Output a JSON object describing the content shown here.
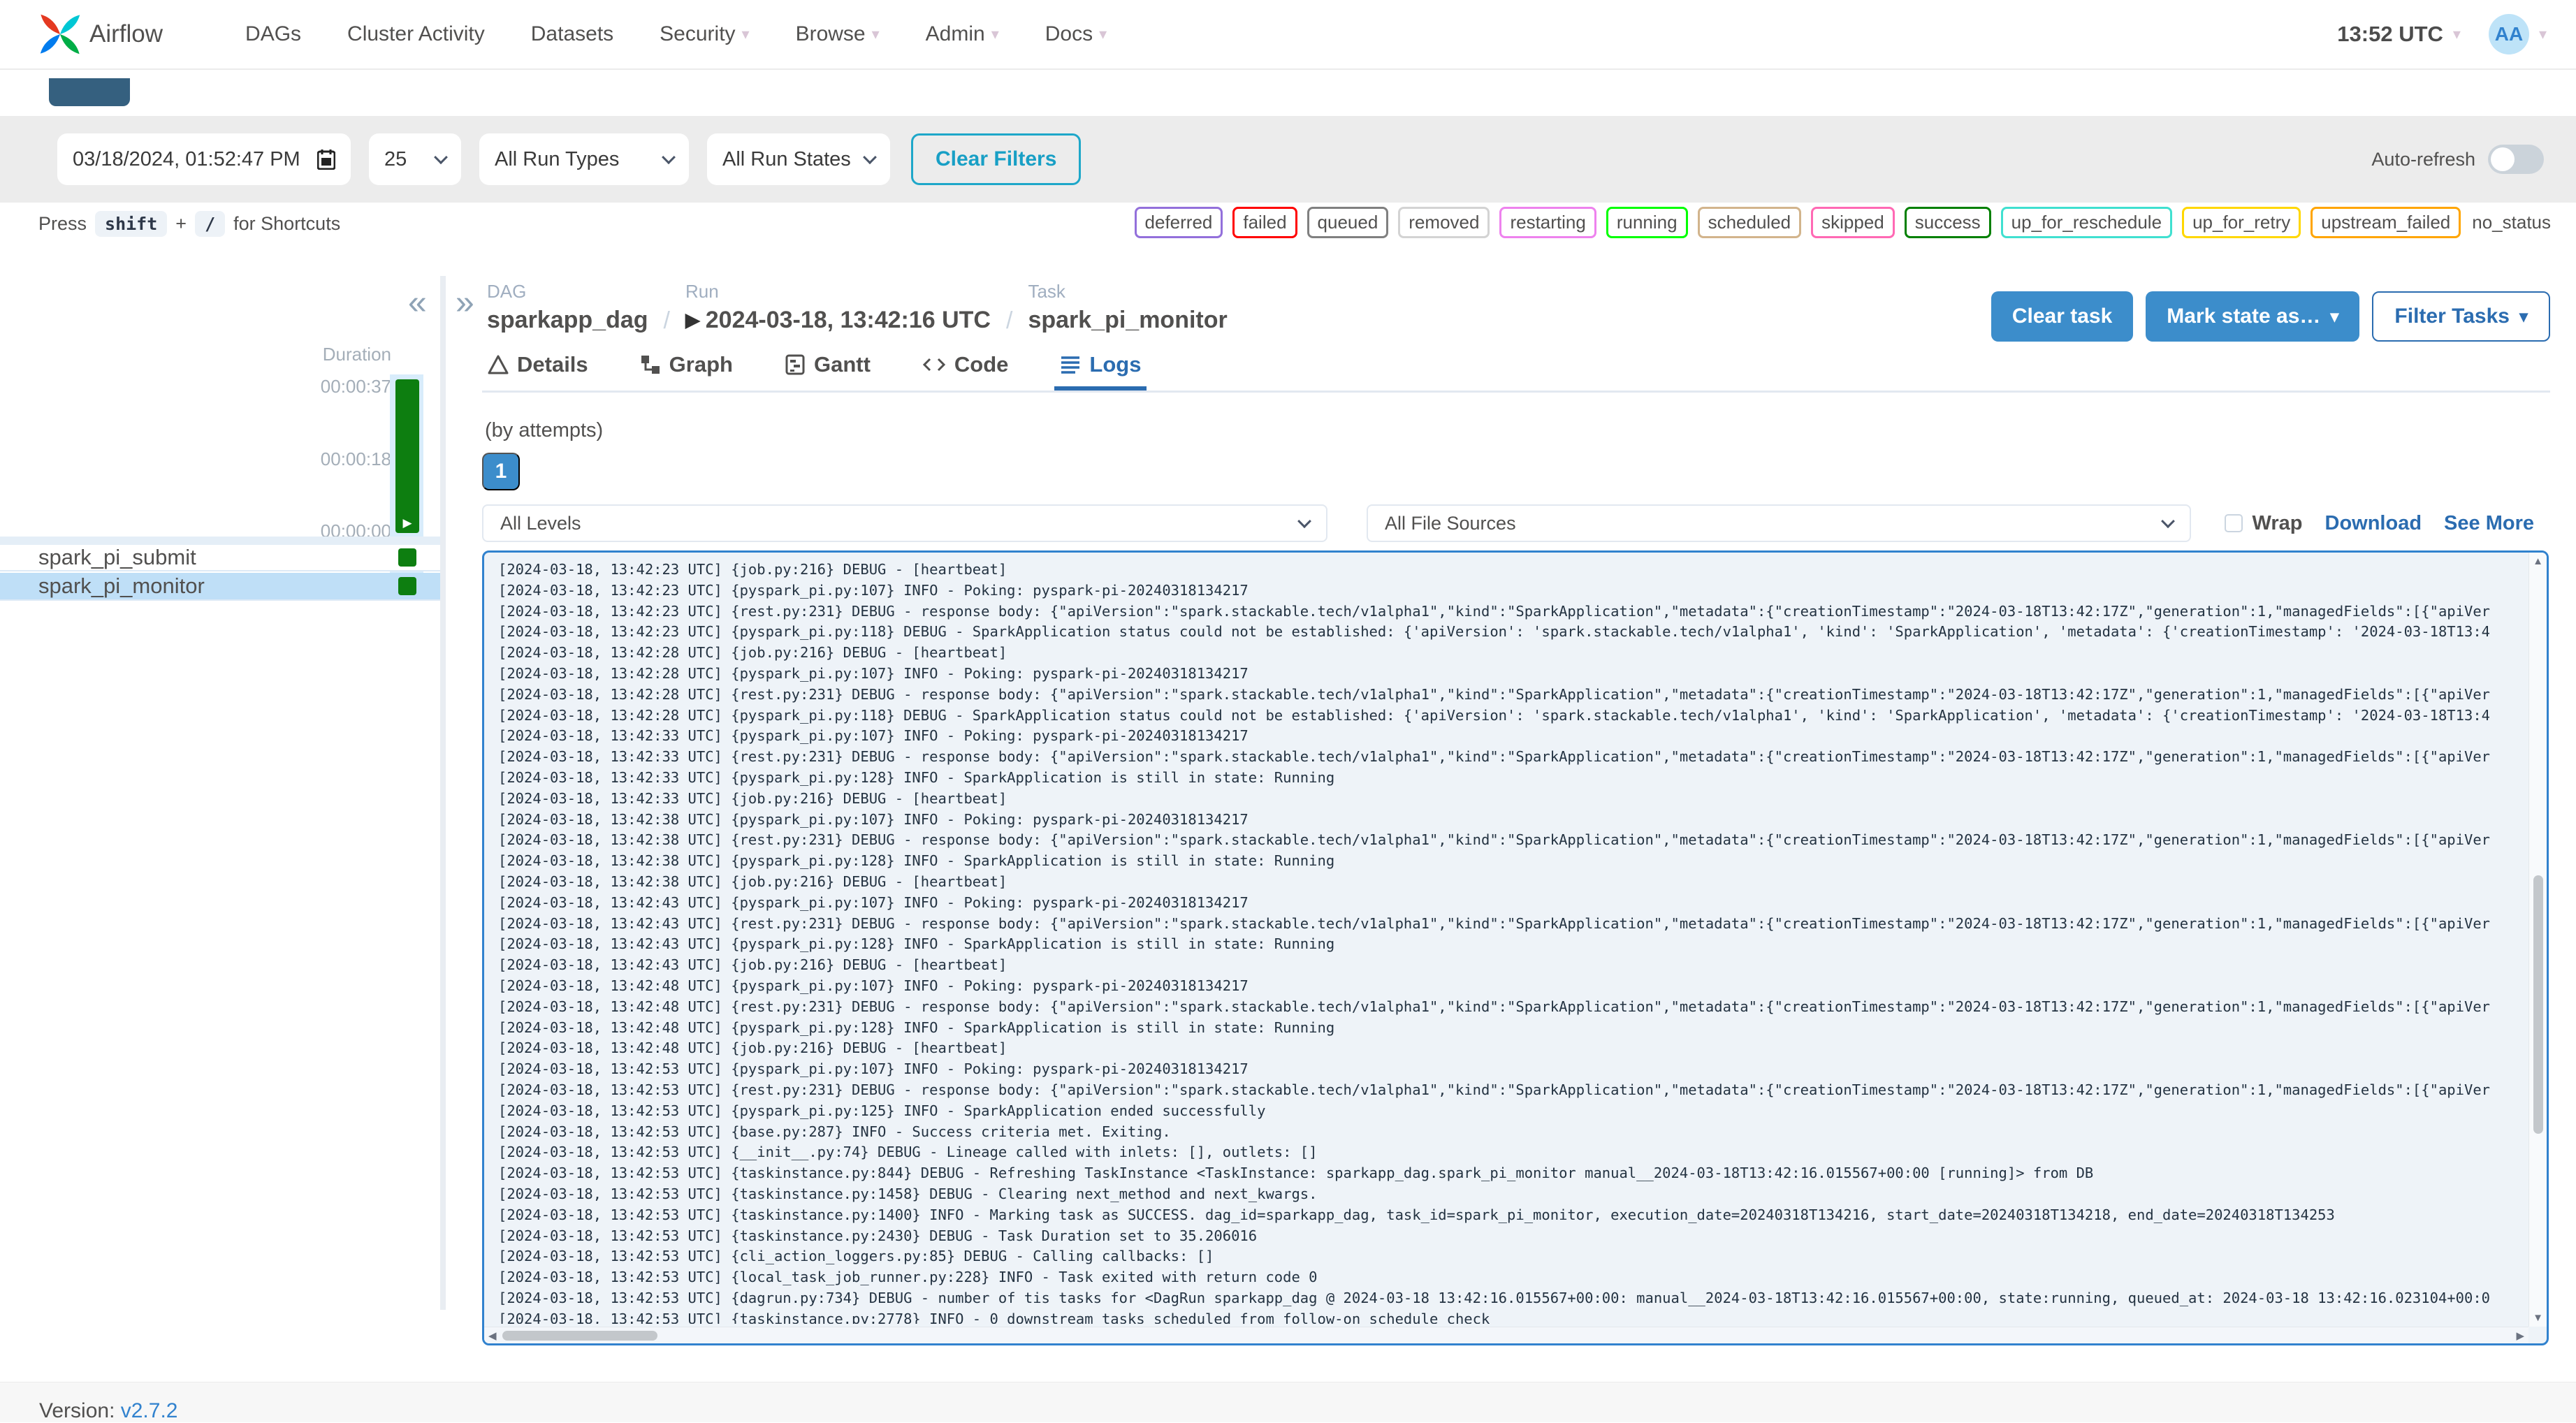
{
  "navbar": {
    "brand": "Airflow",
    "items": [
      {
        "label": "DAGs",
        "caret": false
      },
      {
        "label": "Cluster Activity",
        "caret": false
      },
      {
        "label": "Datasets",
        "caret": false
      },
      {
        "label": "Security",
        "caret": true
      },
      {
        "label": "Browse",
        "caret": true
      },
      {
        "label": "Admin",
        "caret": true
      },
      {
        "label": "Docs",
        "caret": true
      }
    ],
    "clock": "13:52 UTC",
    "avatar_initials": "AA"
  },
  "filter_bar": {
    "date_value": "03/18/2024, 01:52:47 PM",
    "page_size": "25",
    "run_types": "All Run Types",
    "run_states": "All Run States",
    "clear_filters": "Clear Filters",
    "auto_refresh_label": "Auto-refresh"
  },
  "shortcuts": {
    "press": "Press",
    "key1": "shift",
    "plus": "+",
    "key2": "/",
    "suffix": "for Shortcuts"
  },
  "statuses": [
    {
      "label": "deferred",
      "color": "mediumpurple"
    },
    {
      "label": "failed",
      "color": "red"
    },
    {
      "label": "queued",
      "color": "gray"
    },
    {
      "label": "removed",
      "color": "lightgrey"
    },
    {
      "label": "restarting",
      "color": "violet"
    },
    {
      "label": "running",
      "color": "lime"
    },
    {
      "label": "scheduled",
      "color": "tan"
    },
    {
      "label": "skipped",
      "color": "hotpink"
    },
    {
      "label": "success",
      "color": "green"
    },
    {
      "label": "up_for_reschedule",
      "color": "turquoise"
    },
    {
      "label": "up_for_retry",
      "color": "gold"
    },
    {
      "label": "upstream_failed",
      "color": "orange"
    },
    {
      "label": "no_status",
      "plain": true
    }
  ],
  "grid": {
    "duration_label": "Duration",
    "ticks": [
      {
        "t": "00:00:37"
      },
      {
        "t": "00:00:18"
      },
      {
        "t": "00:00:00"
      }
    ],
    "tasks": [
      {
        "name": "spark_pi_submit",
        "selected": false
      },
      {
        "name": "spark_pi_monitor",
        "selected": true
      }
    ]
  },
  "breadcrumb": {
    "dag_label": "DAG",
    "dag": "sparkapp_dag",
    "run_label": "Run",
    "run": "2024-03-18, 13:42:16 UTC",
    "task_label": "Task",
    "task": "spark_pi_monitor"
  },
  "actions": {
    "clear_task": "Clear task",
    "mark_state": "Mark state as…",
    "filter_tasks": "Filter Tasks"
  },
  "tabs": [
    {
      "label": "Details"
    },
    {
      "label": "Graph"
    },
    {
      "label": "Gantt"
    },
    {
      "label": "Code"
    },
    {
      "label": "Logs",
      "active": true
    }
  ],
  "logs": {
    "by_attempts": "(by attempts)",
    "attempt": "1",
    "level_filter": "All Levels",
    "source_filter": "All File Sources",
    "wrap_label": "Wrap",
    "download_label": "Download",
    "see_more_label": "See More",
    "lines": [
      {
        "text": "[2024-03-18, 13:42:23 UTC] {job.py:216} DEBUG - [heartbeat]"
      },
      {
        "text": "[2024-03-18, 13:42:23 UTC] {pyspark_pi.py:107} INFO - Poking: pyspark-pi-20240318134217"
      },
      {
        "text": "[2024-03-18, 13:42:23 UTC] {rest.py:231} DEBUG - response body: {\"apiVersion\":\"spark.stackable.tech/v1alpha1\",\"kind\":\"SparkApplication\",\"metadata\":{\"creationTimestamp\":\"2024-03-18T13:42:17Z\",\"generation\":1,\"managedFields\":[{\"apiVer"
      },
      {
        "text": "[2024-03-18, 13:42:23 UTC] {pyspark_pi.py:118} DEBUG - SparkApplication status could not be established: {'apiVersion': 'spark.stackable.tech/v1alpha1', 'kind': 'SparkApplication', 'metadata': {'creationTimestamp': '2024-03-18T13:4"
      },
      {
        "text": "[2024-03-18, 13:42:28 UTC] {job.py:216} DEBUG - [heartbeat]"
      },
      {
        "text": "[2024-03-18, 13:42:28 UTC] {pyspark_pi.py:107} INFO - Poking: pyspark-pi-20240318134217"
      },
      {
        "text": "[2024-03-18, 13:42:28 UTC] {rest.py:231} DEBUG - response body: {\"apiVersion\":\"spark.stackable.tech/v1alpha1\",\"kind\":\"SparkApplication\",\"metadata\":{\"creationTimestamp\":\"2024-03-18T13:42:17Z\",\"generation\":1,\"managedFields\":[{\"apiVer"
      },
      {
        "text": "[2024-03-18, 13:42:28 UTC] {pyspark_pi.py:118} DEBUG - SparkApplication status could not be established: {'apiVersion': 'spark.stackable.tech/v1alpha1', 'kind': 'SparkApplication', 'metadata': {'creationTimestamp': '2024-03-18T13:4"
      },
      {
        "text": "[2024-03-18, 13:42:33 UTC] {pyspark_pi.py:107} INFO - Poking: pyspark-pi-20240318134217"
      },
      {
        "text": "[2024-03-18, 13:42:33 UTC] {rest.py:231} DEBUG - response body: {\"apiVersion\":\"spark.stackable.tech/v1alpha1\",\"kind\":\"SparkApplication\",\"metadata\":{\"creationTimestamp\":\"2024-03-18T13:42:17Z\",\"generation\":1,\"managedFields\":[{\"apiVer"
      },
      {
        "text": "[2024-03-18, 13:42:33 UTC] {pyspark_pi.py:128} INFO - SparkApplication is still in state: Running"
      },
      {
        "text": "[2024-03-18, 13:42:33 UTC] {job.py:216} DEBUG - [heartbeat]"
      },
      {
        "text": "[2024-03-18, 13:42:38 UTC] {pyspark_pi.py:107} INFO - Poking: pyspark-pi-20240318134217"
      },
      {
        "text": "[2024-03-18, 13:42:38 UTC] {rest.py:231} DEBUG - response body: {\"apiVersion\":\"spark.stackable.tech/v1alpha1\",\"kind\":\"SparkApplication\",\"metadata\":{\"creationTimestamp\":\"2024-03-18T13:42:17Z\",\"generation\":1,\"managedFields\":[{\"apiVer"
      },
      {
        "text": "[2024-03-18, 13:42:38 UTC] {pyspark_pi.py:128} INFO - SparkApplication is still in state: Running"
      },
      {
        "text": "[2024-03-18, 13:42:38 UTC] {job.py:216} DEBUG - [heartbeat]"
      },
      {
        "text": "[2024-03-18, 13:42:43 UTC] {pyspark_pi.py:107} INFO - Poking: pyspark-pi-20240318134217"
      },
      {
        "text": "[2024-03-18, 13:42:43 UTC] {rest.py:231} DEBUG - response body: {\"apiVersion\":\"spark.stackable.tech/v1alpha1\",\"kind\":\"SparkApplication\",\"metadata\":{\"creationTimestamp\":\"2024-03-18T13:42:17Z\",\"generation\":1,\"managedFields\":[{\"apiVer"
      },
      {
        "text": "[2024-03-18, 13:42:43 UTC] {pyspark_pi.py:128} INFO - SparkApplication is still in state: Running"
      },
      {
        "text": "[2024-03-18, 13:42:43 UTC] {job.py:216} DEBUG - [heartbeat]"
      },
      {
        "text": "[2024-03-18, 13:42:48 UTC] {pyspark_pi.py:107} INFO - Poking: pyspark-pi-20240318134217"
      },
      {
        "text": "[2024-03-18, 13:42:48 UTC] {rest.py:231} DEBUG - response body: {\"apiVersion\":\"spark.stackable.tech/v1alpha1\",\"kind\":\"SparkApplication\",\"metadata\":{\"creationTimestamp\":\"2024-03-18T13:42:17Z\",\"generation\":1,\"managedFields\":[{\"apiVer"
      },
      {
        "text": "[2024-03-18, 13:42:48 UTC] {pyspark_pi.py:128} INFO - SparkApplication is still in state: Running"
      },
      {
        "text": "[2024-03-18, 13:42:48 UTC] {job.py:216} DEBUG - [heartbeat]"
      },
      {
        "text": "[2024-03-18, 13:42:53 UTC] {pyspark_pi.py:107} INFO - Poking: pyspark-pi-20240318134217"
      },
      {
        "text": "[2024-03-18, 13:42:53 UTC] {rest.py:231} DEBUG - response body: {\"apiVersion\":\"spark.stackable.tech/v1alpha1\",\"kind\":\"SparkApplication\",\"metadata\":{\"creationTimestamp\":\"2024-03-18T13:42:17Z\",\"generation\":1,\"managedFields\":[{\"apiVer"
      },
      {
        "text": "[2024-03-18, 13:42:53 UTC] {pyspark_pi.py:125} INFO - SparkApplication ended successfully"
      },
      {
        "text": "[2024-03-18, 13:42:53 UTC] {base.py:287} INFO - Success criteria met. Exiting."
      },
      {
        "text": "[2024-03-18, 13:42:53 UTC] {__init__.py:74} DEBUG - Lineage called with inlets: [], outlets: []"
      },
      {
        "text": "[2024-03-18, 13:42:53 UTC] {taskinstance.py:844} DEBUG - Refreshing TaskInstance <TaskInstance: sparkapp_dag.spark_pi_monitor manual__2024-03-18T13:42:16.015567+00:00 [running]> from DB"
      },
      {
        "text": "[2024-03-18, 13:42:53 UTC] {taskinstance.py:1458} DEBUG - Clearing next_method and next_kwargs."
      },
      {
        "text": "[2024-03-18, 13:42:53 UTC] {taskinstance.py:1400} INFO - Marking task as SUCCESS. dag_id=sparkapp_dag, task_id=spark_pi_monitor, execution_date=20240318T134216, start_date=20240318T134218, end_date=20240318T134253"
      },
      {
        "text": "[2024-03-18, 13:42:53 UTC] {taskinstance.py:2430} DEBUG - Task Duration set to 35.206016"
      },
      {
        "text": "[2024-03-18, 13:42:53 UTC] {cli_action_loggers.py:85} DEBUG - Calling callbacks: []"
      },
      {
        "text": "[2024-03-18, 13:42:53 UTC] {local_task_job_runner.py:228} INFO - Task exited with return code 0"
      },
      {
        "text": "[2024-03-18, 13:42:53 UTC] {dagrun.py:734} DEBUG - number of tis tasks for <DagRun sparkapp_dag @ 2024-03-18 13:42:16.015567+00:00: manual__2024-03-18T13:42:16.015567+00:00, state:running, queued_at: 2024-03-18 13:42:16.023104+00:0"
      },
      {
        "text": "[2024-03-18, 13:42:53 UTC] {taskinstance.py:2778} INFO - 0 downstream tasks scheduled from follow-on schedule check"
      }
    ]
  },
  "footer": {
    "version_label": "Version:",
    "version": "v2.7.2"
  }
}
